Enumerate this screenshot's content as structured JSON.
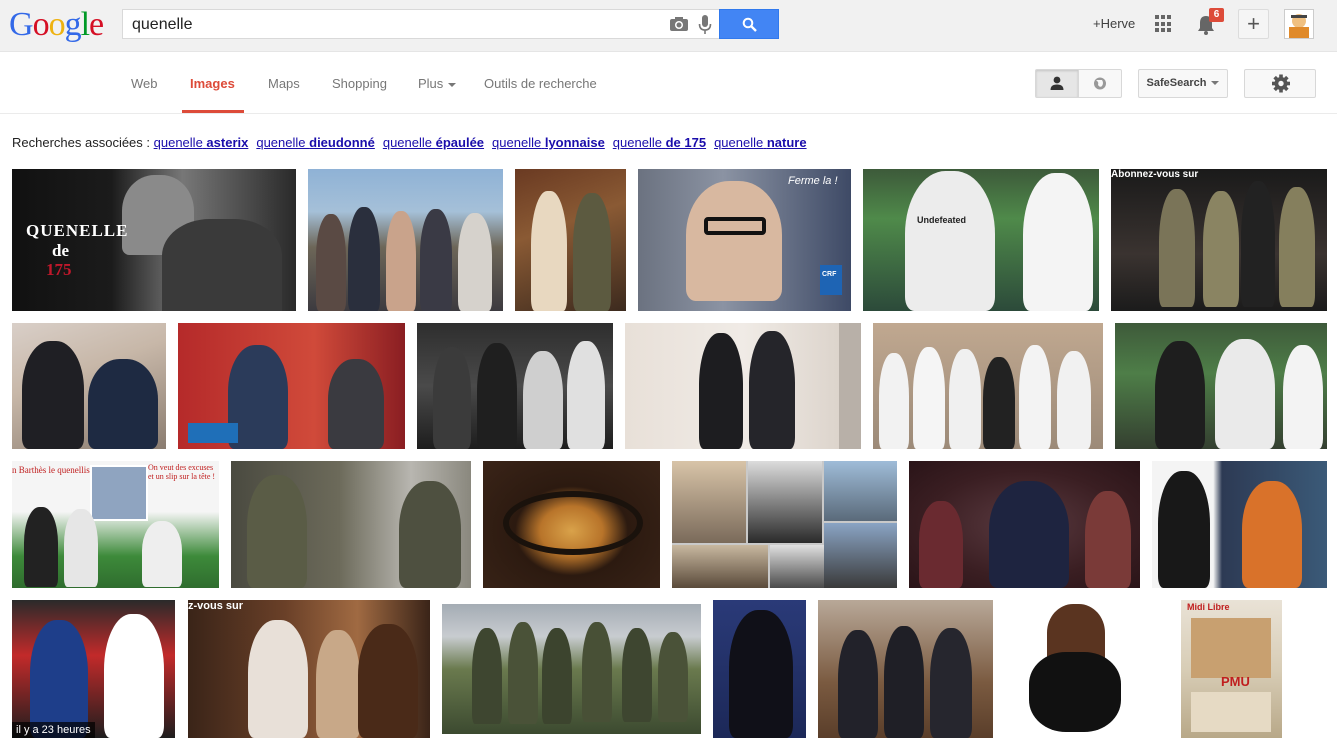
{
  "header": {
    "logo_letters": [
      "G",
      "o",
      "o",
      "g",
      "l",
      "e"
    ],
    "logo_colors": [
      "#3369e8",
      "#d50f25",
      "#eeb211",
      "#3369e8",
      "#009925",
      "#d50f25"
    ],
    "search_value": "quenelle",
    "user_link": "+Herve",
    "notification_count": "6"
  },
  "nav": {
    "items": [
      "Web",
      "Images",
      "Maps",
      "Shopping",
      "Plus",
      "Outils de recherche"
    ],
    "active": "Images",
    "safesearch_label": "SafeSearch"
  },
  "related": {
    "label": "Recherches associées :",
    "links": [
      {
        "prefix": "quenelle",
        "bold": "asterix"
      },
      {
        "prefix": "quenelle",
        "bold": "dieudonné"
      },
      {
        "prefix": "quenelle",
        "bold": "épaulée"
      },
      {
        "prefix": "quenelle",
        "bold": "lyonnaise"
      },
      {
        "prefix": "quenelle",
        "bold": "de 175"
      },
      {
        "prefix": "quenelle",
        "bold": "nature"
      }
    ]
  },
  "images": {
    "overlay_texts": {
      "quenelle_title": "QUENELLE",
      "quenelle_de": "de",
      "quenelle_175": "175",
      "ferme_la": "Ferme la !",
      "abonnez": "Abonnez-vous sur",
      "excuses": "On veut des excuses et un slip sur la tête !",
      "on_barthes": "n Barthès le quenelliste !",
      "midi_libre": "Midi Libre",
      "pmu": "PMU",
      "vous_sur": "z-vous sur",
      "crf": "CRF",
      "undefeated": "Undefeated"
    },
    "time_badge": "il y a 23 heures"
  },
  "colors": {
    "search_button": "#4285f4",
    "active_tab": "#dd4b39",
    "link": "#1a0dab",
    "badge": "#dd4b39"
  }
}
